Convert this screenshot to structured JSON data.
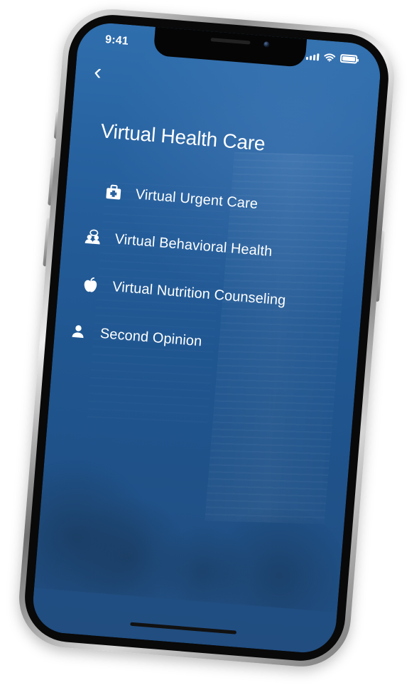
{
  "status": {
    "time": "9:41",
    "icons": {
      "signal": "signal-icon",
      "wifi": "wifi-icon",
      "battery": "battery-icon"
    }
  },
  "nav": {
    "back_icon": "back-chevron-icon"
  },
  "page": {
    "title": "Virtual Health Care"
  },
  "menu": {
    "items": [
      {
        "label": "Virtual Urgent Care",
        "icon": "medical-kit-icon"
      },
      {
        "label": "Virtual Behavioral Health",
        "icon": "people-chat-icon"
      },
      {
        "label": "Virtual Nutrition Counseling",
        "icon": "apple-icon"
      },
      {
        "label": "Second Opinion",
        "icon": "person-icon"
      }
    ]
  },
  "colors": {
    "screen_bg_top": "#2f6ead",
    "screen_bg_bottom": "#214d80",
    "text": "#ffffff"
  }
}
